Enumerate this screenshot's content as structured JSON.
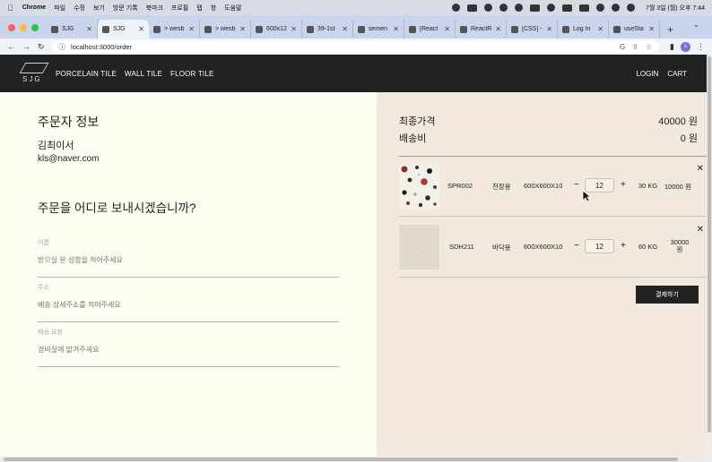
{
  "menubar": {
    "apple": "",
    "app": "Chrome",
    "items": [
      "파일",
      "수정",
      "보기",
      "방문 기록",
      "북마크",
      "프로필",
      "탭",
      "창",
      "도움말"
    ],
    "clock": "7월 3일 (월) 오후 7:44"
  },
  "tabs": [
    {
      "label": "SJG",
      "active": false
    },
    {
      "label": "SJG",
      "active": true
    },
    {
      "label": "> wesb",
      "active": false
    },
    {
      "label": "> wesb",
      "active": false
    },
    {
      "label": "600x12",
      "active": false
    },
    {
      "label": "39-1st",
      "active": false
    },
    {
      "label": "semen",
      "active": false
    },
    {
      "label": "[React",
      "active": false
    },
    {
      "label": "ReactR",
      "active": false
    },
    {
      "label": "[CSS] -",
      "active": false
    },
    {
      "label": "Log In",
      "active": false
    },
    {
      "label": "useSta",
      "active": false
    }
  ],
  "browser": {
    "url": "localhost:3000/order",
    "new_tab": "+",
    "profile_initial": "s"
  },
  "site": {
    "logo_text": "SJG",
    "nav": [
      "PORCELAIN TILE",
      "WALL TILE",
      "FLOOR TILE"
    ],
    "login": "LOGIN",
    "cart": "CART"
  },
  "orderer": {
    "heading": "주문자 정보",
    "name": "김최이서",
    "email": "kls@naver.com"
  },
  "shipping": {
    "heading": "주문을 어디로 보내시겠습니까?",
    "fields": [
      {
        "label": "이름",
        "placeholder": "받으실 분 성함을 적어주세요"
      },
      {
        "label": "주소",
        "placeholder": "배송 상세주소를 적어주세요"
      },
      {
        "label": "배송 요청",
        "placeholder": "경비실에 맡겨주세요"
      }
    ]
  },
  "summary": {
    "total_label": "최종가격",
    "total_value": "40000 원",
    "shipping_label": "배송비",
    "shipping_value": "0 원"
  },
  "cart_items": [
    {
      "code": "SPR002",
      "usage": "천장용",
      "size": "600X600X10",
      "qty": "12",
      "weight": "30 KG",
      "price": "10000 원",
      "minus": "−",
      "plus": "+",
      "remove": "✕"
    },
    {
      "code": "SDH211",
      "usage": "바닥용",
      "size": "600X600X10",
      "qty": "12",
      "weight": "60 KG",
      "price_line1": "30000",
      "price_line2": "원",
      "minus": "−",
      "plus": "+",
      "remove": "✕"
    }
  ],
  "pay_button": "결제하기",
  "colors": {
    "nav_bg": "#222222",
    "left_bg": "#fdfdf1",
    "right_bg": "#f2e8de",
    "button_bg": "#222222"
  }
}
